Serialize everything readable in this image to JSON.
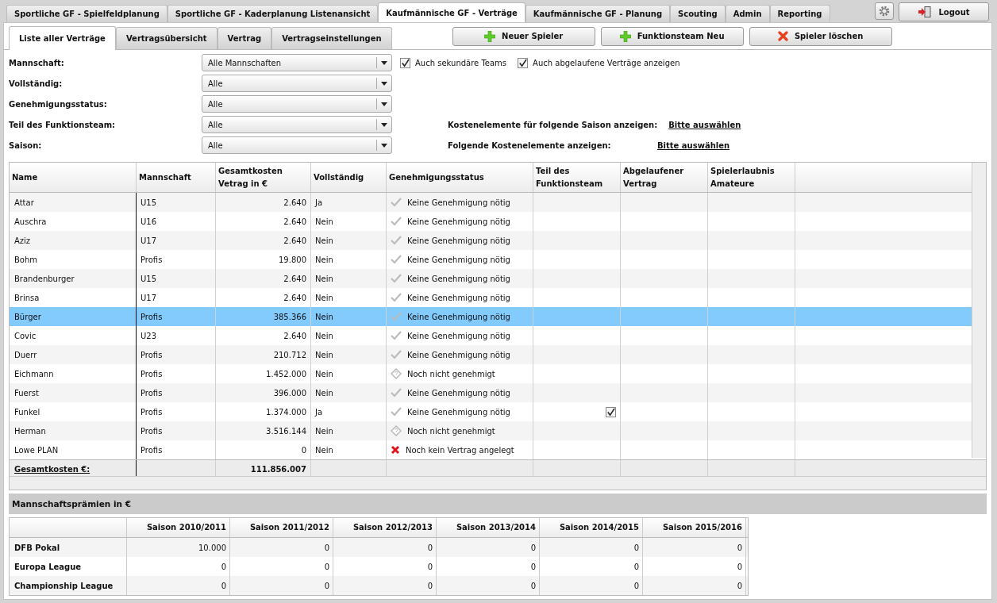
{
  "main_tabs": [
    {
      "label": "Sportliche GF - Spielfeldplanung",
      "selected": false
    },
    {
      "label": "Sportliche GF - Kaderplanung Listenansicht",
      "selected": false
    },
    {
      "label": "Kaufmännische GF - Verträge",
      "selected": true
    },
    {
      "label": "Kaufmännische GF - Planung",
      "selected": false
    },
    {
      "label": "Scouting",
      "selected": false
    },
    {
      "label": "Admin",
      "selected": false
    },
    {
      "label": "Reporting",
      "selected": false
    }
  ],
  "logout_button": "Logout",
  "sub_tabs": [
    {
      "label": "Liste aller Verträge",
      "selected": true
    },
    {
      "label": "Vertragsübersicht",
      "selected": false
    },
    {
      "label": "Vertrag",
      "selected": false
    },
    {
      "label": "Vertragseinstellungen",
      "selected": false
    }
  ],
  "action_buttons": [
    {
      "label": "Neuer Spieler",
      "kind": "add"
    },
    {
      "label": "Funktionsteam Neu",
      "kind": "add"
    },
    {
      "label": "Spieler löschen",
      "kind": "delete"
    }
  ],
  "filters": [
    {
      "label": "Mannschaft:",
      "value": "Alle Mannschaften"
    },
    {
      "label": "Vollständig:",
      "value": "Alle"
    },
    {
      "label": "Genehmigungsstatus:",
      "value": "Alle"
    },
    {
      "label": "Teil des Funktionsteam:",
      "value": "Alle"
    },
    {
      "label": "Saison:",
      "value": "Alle"
    }
  ],
  "checkboxes": [
    {
      "label": "Auch sekundäre Teams",
      "checked": true
    },
    {
      "label": "Auch abgelaufene Verträge anzeigen",
      "checked": true
    }
  ],
  "cost_options": [
    {
      "label": "Kostenelemente für folgende Saison anzeigen:",
      "link": "Bitte auswählen"
    },
    {
      "label": "Folgende Kostenelemente anzeigen:",
      "link": "Bitte auswählen"
    }
  ],
  "table": {
    "columns": [
      "Name",
      "Mannschaft",
      "Gesamtkosten Vetrag in €",
      "Vollständig",
      "Genehmigungsstatus",
      "Teil des Funktionsteam",
      "Abgelaufener Vertrag",
      "Spielerlaubnis Amateure"
    ],
    "rows": [
      {
        "name": "Attar",
        "team": "U15",
        "cost": "2.640",
        "complete": "Ja",
        "status": {
          "kind": "not_required",
          "text": "Keine Genehmigung nötig"
        },
        "funktionsteam": false,
        "selected": false
      },
      {
        "name": "Auschra",
        "team": "U16",
        "cost": "2.640",
        "complete": "Nein",
        "status": {
          "kind": "not_required",
          "text": "Keine Genehmigung nötig"
        },
        "funktionsteam": false,
        "selected": false
      },
      {
        "name": "Aziz",
        "team": "U17",
        "cost": "2.640",
        "complete": "Nein",
        "status": {
          "kind": "not_required",
          "text": "Keine Genehmigung nötig"
        },
        "funktionsteam": false,
        "selected": false
      },
      {
        "name": "Bohm",
        "team": "Profis",
        "cost": "19.800",
        "complete": "Nein",
        "status": {
          "kind": "not_required",
          "text": "Keine Genehmigung nötig"
        },
        "funktionsteam": false,
        "selected": false
      },
      {
        "name": "Brandenburger",
        "team": "U15",
        "cost": "2.640",
        "complete": "Nein",
        "status": {
          "kind": "not_required",
          "text": "Keine Genehmigung nötig"
        },
        "funktionsteam": false,
        "selected": false
      },
      {
        "name": "Brinsa",
        "team": "U17",
        "cost": "2.640",
        "complete": "Nein",
        "status": {
          "kind": "not_required",
          "text": "Keine Genehmigung nötig"
        },
        "funktionsteam": false,
        "selected": false
      },
      {
        "name": "Bürger",
        "team": "Profis",
        "cost": "385.366",
        "complete": "Nein",
        "status": {
          "kind": "not_required",
          "text": "Keine Genehmigung nötig"
        },
        "funktionsteam": false,
        "selected": true
      },
      {
        "name": "Covic",
        "team": "U23",
        "cost": "2.640",
        "complete": "Nein",
        "status": {
          "kind": "not_required",
          "text": "Keine Genehmigung nötig"
        },
        "funktionsteam": false,
        "selected": false
      },
      {
        "name": "Duerr",
        "team": "Profis",
        "cost": "210.712",
        "complete": "Nein",
        "status": {
          "kind": "not_required",
          "text": "Keine Genehmigung nötig"
        },
        "funktionsteam": false,
        "selected": false
      },
      {
        "name": "Eichmann",
        "team": "Profis",
        "cost": "1.452.000",
        "complete": "Nein",
        "status": {
          "kind": "pending",
          "text": "Noch nicht genehmigt"
        },
        "funktionsteam": false,
        "selected": false
      },
      {
        "name": "Fuerst",
        "team": "Profis",
        "cost": "396.000",
        "complete": "Nein",
        "status": {
          "kind": "not_required",
          "text": "Keine Genehmigung nötig"
        },
        "funktionsteam": false,
        "selected": false
      },
      {
        "name": "Funkel",
        "team": "Profis",
        "cost": "1.374.000",
        "complete": "Ja",
        "status": {
          "kind": "not_required",
          "text": "Keine Genehmigung nötig"
        },
        "funktionsteam": true,
        "selected": false
      },
      {
        "name": "Herman",
        "team": "Profis",
        "cost": "3.516.144",
        "complete": "Nein",
        "status": {
          "kind": "pending",
          "text": "Noch nicht genehmigt"
        },
        "funktionsteam": false,
        "selected": false
      },
      {
        "name": "Lowe PLAN",
        "team": "Profis",
        "cost": "0",
        "complete": "Nein",
        "status": {
          "kind": "missing",
          "text": "Noch kein Vertrag angelegt"
        },
        "funktionsteam": false,
        "selected": false
      }
    ],
    "footer": {
      "label": "Gesamtkosten €:",
      "total": "111.856.007"
    }
  },
  "bonus": {
    "title": "Mannschaftsprämien in €",
    "columns": [
      "Saison 2010/2011",
      "Saison 2011/2012",
      "Saison 2012/2013",
      "Saison 2013/2014",
      "Saison 2014/2015",
      "Saison 2015/2016"
    ],
    "rows": [
      {
        "label": "DFB Pokal",
        "values": [
          "10.000",
          "0",
          "0",
          "0",
          "0",
          "0"
        ]
      },
      {
        "label": "Europa League",
        "values": [
          "0",
          "0",
          "0",
          "0",
          "0",
          "0"
        ]
      },
      {
        "label": "Championship League",
        "values": [
          "0",
          "0",
          "0",
          "0",
          "0",
          "0"
        ]
      }
    ]
  }
}
